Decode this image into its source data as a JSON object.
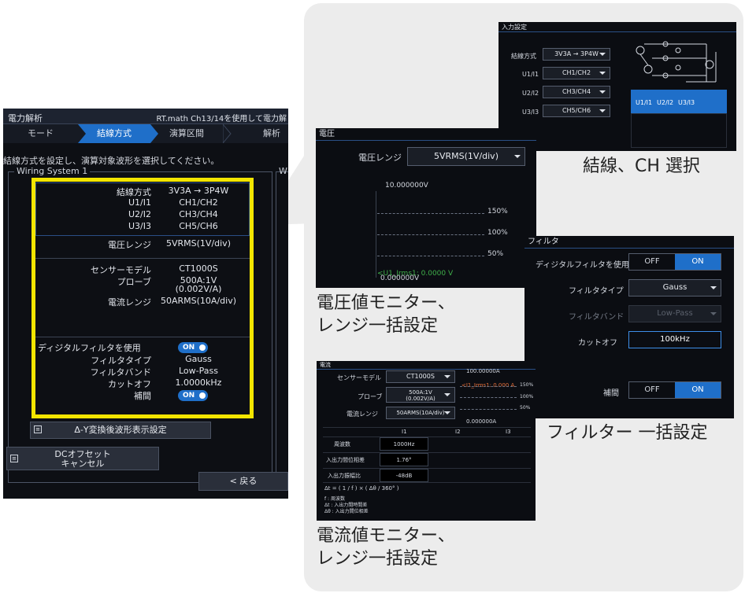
{
  "main": {
    "title": "電力解析",
    "title_right": "RT.math Ch13/14を使用して電力解",
    "tabs": [
      {
        "label": "モード"
      },
      {
        "label": "結線方式"
      },
      {
        "label": "演算区間"
      },
      {
        "label": "解析"
      }
    ],
    "instruction": "結線方式を設定し、演算対象波形を選択してください。",
    "wiring_label": "Wiring System 1",
    "wiring2_label": "W",
    "rows": {
      "wiring_method_label": "結線方式",
      "wiring_method_value": "3V3A → 3P4W",
      "u1_label": "U1/I1",
      "u1_value": "CH1/CH2",
      "u2_label": "U2/I2",
      "u2_value": "CH3/CH4",
      "u3_label": "U3/I3",
      "u3_value": "CH5/CH6",
      "voltage_range_label": "電圧レンジ",
      "voltage_range_value": "5VRMS(1V/div)",
      "sensor_label": "センサーモデル",
      "sensor_value": "CT1000S",
      "probe_label": "プローブ",
      "probe_value_1": "500A:1V",
      "probe_value_2": "(0.002V/A)",
      "current_range_label": "電流レンジ",
      "current_range_value": "50ARMS(10A/div)",
      "digital_filter_label": "ディジタルフィルタを使用",
      "filter_type_label": "フィルタタイプ",
      "filter_type_value": "Gauss",
      "filter_band_label": "フィルタバンド",
      "filter_band_value": "Low-Pass",
      "cutoff_label": "カットオフ",
      "cutoff_value": "1.0000kHz",
      "interp_label": "補間",
      "toggle_on": "ON"
    },
    "delta_button": "Δ-Y変換後波形表示設定",
    "dc_offset_button_1": "DCオフセット",
    "dc_offset_button_2": "キャンセル",
    "back_button": "< 戻る"
  },
  "wiring_screen": {
    "title": "入力設定",
    "method_label": "結線方式",
    "method_value": "3V3A → 3P4W",
    "u1_label": "U1/I1",
    "u1_value": "CH1/CH2",
    "u2_label": "U2/I2",
    "u2_value": "CH3/CH4",
    "u3_label": "U3/I3",
    "u3_value": "CH5/CH6",
    "table_headers": [
      "U1/I1",
      "U2/I2",
      "U3/I3"
    ],
    "caption": "結線、CH 選択"
  },
  "voltage_screen": {
    "title": "電圧",
    "range_label": "電圧レンジ",
    "range_value": "5VRMS(1V/div)",
    "top_value": "10.000000V",
    "pct_150": "150%",
    "pct_100": "100%",
    "pct_50": "50%",
    "bottom_value": "0.000000V",
    "overlay": "<U1_Irms1: 0.0000 V",
    "caption_1": "電圧値モニター、",
    "caption_2": "レンジ一括設定"
  },
  "filter_screen": {
    "title": "フィルタ",
    "use_label": "ディジタルフィルタを使用",
    "off": "OFF",
    "on": "ON",
    "type_label": "フィルタタイプ",
    "type_value": "Gauss",
    "band_label": "フィルタバンド",
    "band_value": "Low-Pass",
    "cutoff_label": "カットオフ",
    "cutoff_value": "100kHz",
    "interp_label": "補間",
    "caption": "フィルター 一括設定"
  },
  "current_screen": {
    "title": "電流",
    "sensor_label": "センサーモデル",
    "sensor_value": "CT1000S",
    "probe_label": "プローブ",
    "probe_value_1": "500A:1V",
    "probe_value_2": "(0.002V/A)",
    "range_label": "電流レンジ",
    "range_value": "50ARMS(10A/div)",
    "top_value": "100.00000A",
    "overlay": "<I1_Irms1: 0.000 A",
    "pct_150": "150%",
    "pct_100": "100%",
    "pct_50": "50%",
    "bottom_value": "0.000000A",
    "col_headers": [
      "I1",
      "I2",
      "I3"
    ],
    "row1_label": "周波数",
    "row1_value": "1000Hz",
    "row2_label": "入出力間位相差",
    "row2_value": "1.76°",
    "row3_label": "入出力振幅比",
    "row3_value": "-48dB",
    "formula": "Δt = ( 1 / f ) × ( Δθ / 360° )",
    "legend_1": "f : 周波数",
    "legend_2": "Δt : 入出力間時間差",
    "legend_3": "Δθ : 入出力間位相差",
    "caption_1": "電流値モニター、",
    "caption_2": "レンジ一括設定"
  },
  "colors": {
    "highlight": "#f2e500",
    "accent_blue": "#1f6fc9",
    "screen_bg": "#0b0d12",
    "bubble_bg": "#ececec"
  }
}
